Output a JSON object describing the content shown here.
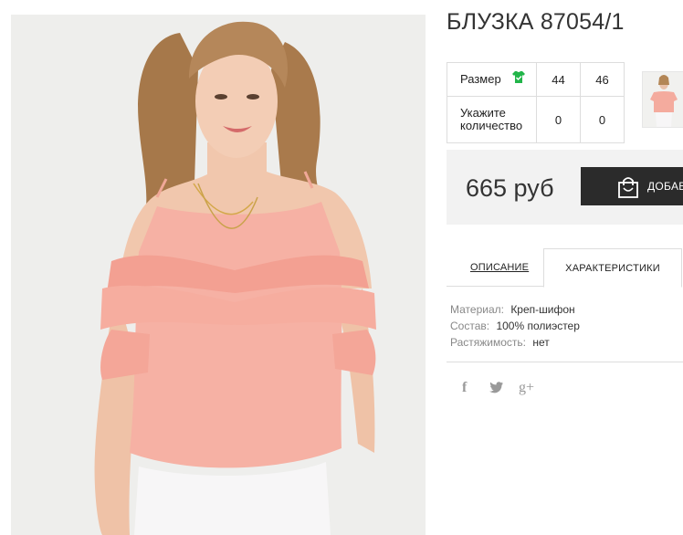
{
  "product": {
    "title": "БЛУЗКА 87054/1",
    "image_alt": "product-photo-pink-cold-shoulder-blouse"
  },
  "sizes": {
    "size_label": "Размер",
    "quantity_label": "Укажите количество",
    "values": [
      "44",
      "46"
    ],
    "quantities": [
      "0",
      "0"
    ]
  },
  "price": {
    "value": "665 руб",
    "add_to_cart_label": "ДОБАВ"
  },
  "tabs": {
    "description": "ОПИСАНИЕ",
    "characteristics": "ХАРАКТЕРИСТИКИ"
  },
  "specs": [
    {
      "name": "Материал:",
      "value": "Креп-шифон"
    },
    {
      "name": "Состав:",
      "value": "100% полиэстер"
    },
    {
      "name": "Растяжимость:",
      "value": "нет"
    }
  ],
  "social": {
    "facebook": "f",
    "twitter": "twitter-icon",
    "googleplus": "g+"
  },
  "colors": {
    "accent_green": "#22b54a",
    "button_dark": "#2b2b2b",
    "price_bg": "#f2f2f2",
    "blouse": "#f5a99c"
  }
}
